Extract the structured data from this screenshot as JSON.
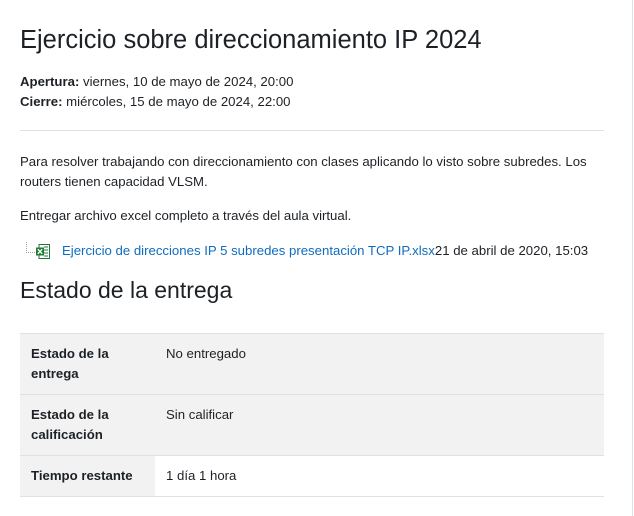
{
  "page": {
    "title": "Ejercicio sobre direccionamiento IP 2024"
  },
  "dates": {
    "open_label": "Apertura:",
    "open_value": " viernes, 10 de mayo de 2024, 20:00",
    "close_label": "Cierre:",
    "close_value": " miércoles, 15 de mayo de 2024, 22:00"
  },
  "intro": {
    "paragraph_1": "Para resolver trabajando con direccionamiento con clases aplicando lo visto sobre subredes. Los routers tienen capacidad VLSM.",
    "paragraph_2": "Entregar archivo excel completo a través del aula virtual."
  },
  "attachment": {
    "icon": "excel-file-icon",
    "filename": "Ejercicio de direcciones IP 5 subredes presentación TCP IP.xlsx",
    "date": "21 de abril de 2020, 15:03"
  },
  "submission": {
    "heading": "Estado de la entrega",
    "rows": [
      {
        "label": "Estado de la entrega",
        "value": "No entregado"
      },
      {
        "label": "Estado de la calificación",
        "value": "Sin calificar"
      },
      {
        "label": "Tiempo restante",
        "value": "1 día 1 hora"
      }
    ]
  },
  "colors": {
    "link": "#0f6cbf",
    "text": "#1d2125",
    "row_shade": "#f2f2f2",
    "border": "#dee2e6",
    "excel_green": "#1f7a3a"
  }
}
